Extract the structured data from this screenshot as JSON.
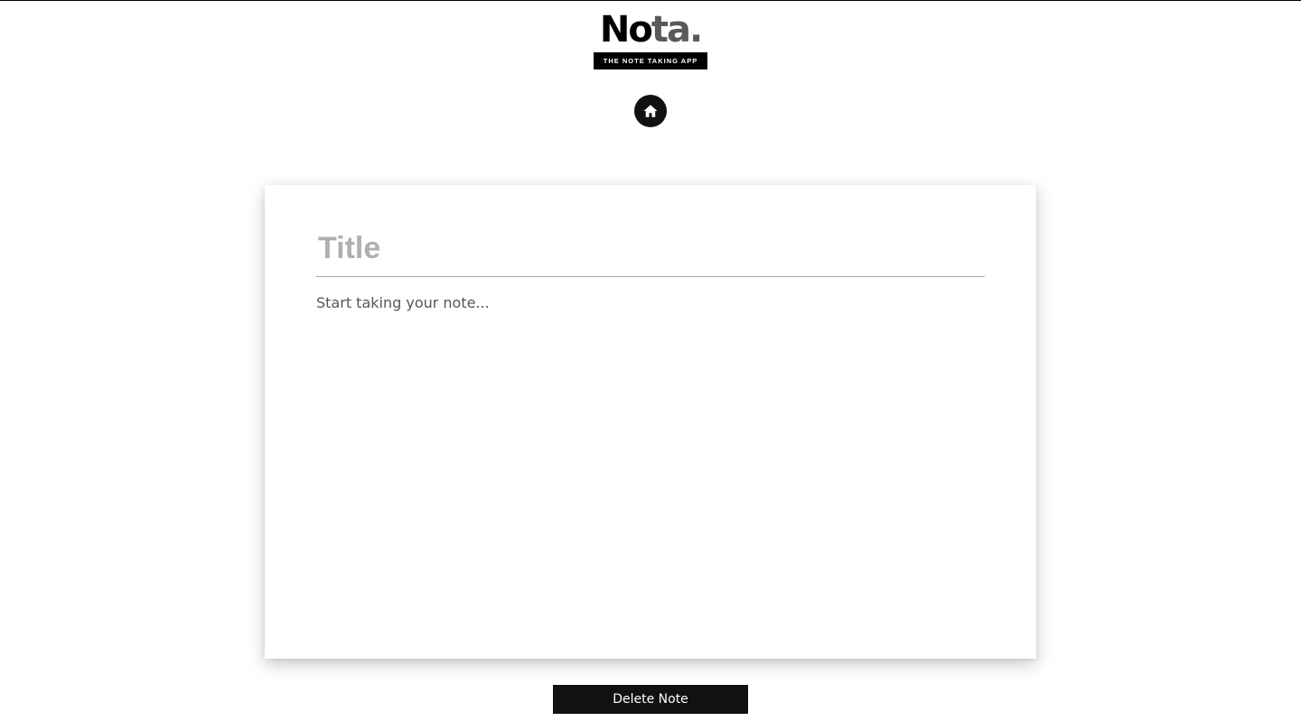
{
  "logo": {
    "word_dark": "No",
    "word_gray": "ta.",
    "tagline": "THE NOTE TAKING APP"
  },
  "nav": {
    "home_icon": "home-icon"
  },
  "note": {
    "title_value": "",
    "title_placeholder": "Title",
    "body_value": "",
    "body_placeholder": "Start taking your note..."
  },
  "actions": {
    "delete_label": "Delete Note"
  },
  "colors": {
    "primary": "#111111",
    "background": "#ffffff",
    "title_placeholder": "#b0b0b0",
    "divider": "#a8a8a8"
  }
}
